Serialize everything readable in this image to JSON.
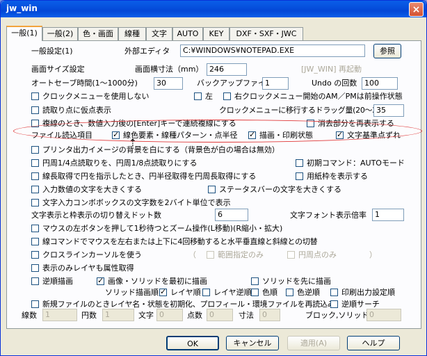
{
  "window": {
    "title": "jw_win",
    "close_glyph": "×"
  },
  "tabs": [
    "一般(1)",
    "一般(2)",
    "色・画面",
    "線種",
    "文字",
    "AUTO",
    "KEY",
    "DXF・SXF・JWC"
  ],
  "general": {
    "section_label": "一般設定(1)",
    "editor_label": "外部エディタ",
    "editor_value": "C:¥WINDOWS¥NOTEPAD.EXE",
    "browse_button": "参照"
  },
  "screen_size": {
    "label": "画面サイズ設定",
    "width_label": "画面横寸法（mm）",
    "width_value": "246",
    "restart_hint": "[JW_WIN] 再起動"
  },
  "autosave": {
    "label": "オートセーブ時間(1〜1000分)",
    "value": "30",
    "backup_label": "バックアップファイル数",
    "backup_value": "1",
    "undo_label": "Undo の回数",
    "undo_value": "100"
  },
  "rows": {
    "clock_menu": "クロックメニューを使用しない",
    "left": "左",
    "right_clock": "右クロックメニュー開始のAM／PMは前操作状態",
    "read_point": "読取り点に仮点表示",
    "drag_label": "クロックメニューに移行するドラッグ量(20〜200)",
    "drag_value": "35",
    "continuous_copy": "複線のとき、数値入力後の[Enter]キーで連続複線にする",
    "erase_redisplay": "消去部分を再表示する",
    "file_read_label": "ファイル読込項目",
    "file_read_line": "線色要素・線種パターン・点半径",
    "file_read_print": "描画・印刷状態",
    "file_read_text": "文字基準点ずれ",
    "printer_white": "プリンタ出力イメージの背景を白にする（背景色が白の場合は無効）",
    "circle_quarter": "円周1/4点読取りを、円周1/8点読取りにする",
    "initial_command": "初期コマンド：AUTOモード",
    "half_diameter": "線長取得で円を指示したとき、円半径取得を円周長取得にする",
    "paper_frame": "用紙枠を表示する",
    "big_input": "入力数値の文字を大きくする",
    "big_status": "ステータスバーの文字を大きくする",
    "text_box_2byte": "文字入力コンボボックスの文字数を2バイト単位で表示",
    "text_switch_label": "文字表示と枠表示の切り替えドット数",
    "text_switch_value": "6",
    "font_ratio_label": "文字フォント表示倍率",
    "font_ratio_value": "1",
    "mouse_zoom": "マウスの左ボタンを押して1秒待つとズーム操作(L移動)(R縮小・拡大)",
    "line_switch": "線コマンドでマウスを左右または上下に4回移動すると水平垂直線と斜線との切替",
    "cross_cursor": "クロスラインカーソルを使う",
    "paren_open": "（",
    "range_only": "範囲指定のみ",
    "circle_point_only": "円周点のみ",
    "paren_close": "）",
    "show_layer_attr": "表示のみレイヤも属性取得",
    "reverse_draw": "逆順描画",
    "image_solid_first": "画像・ソリッドを最初に描画",
    "solid_first": "ソリッドを先に描画",
    "solid_order_label": "ソリッド描画順",
    "layer_order": "レイヤ順",
    "layer_reverse": "レイヤ逆順",
    "color_order": "色順",
    "color_reverse": "色逆順",
    "print_order_setting": "印刷出力設定順",
    "reread_new": "新規ファイルのときレイヤ名・状態を初期化、プロフィール・環境ファイルを再読込み",
    "reverse_search": "逆順サーチ"
  },
  "stats": {
    "lines_label": "線数",
    "lines": "1",
    "arcs_label": "円数",
    "arcs": "1",
    "texts_label": "文字",
    "texts": "0",
    "points_label": "点数",
    "points": "0",
    "dims_label": "寸法",
    "dims": "0",
    "block_label": "ブロック,ソリッド",
    "blocks": "0"
  },
  "buttons": {
    "ok": "OK",
    "cancel": "キャンセル",
    "apply": "適用(A)",
    "help": "ヘルプ"
  },
  "annotation_color": "#e03a3a"
}
